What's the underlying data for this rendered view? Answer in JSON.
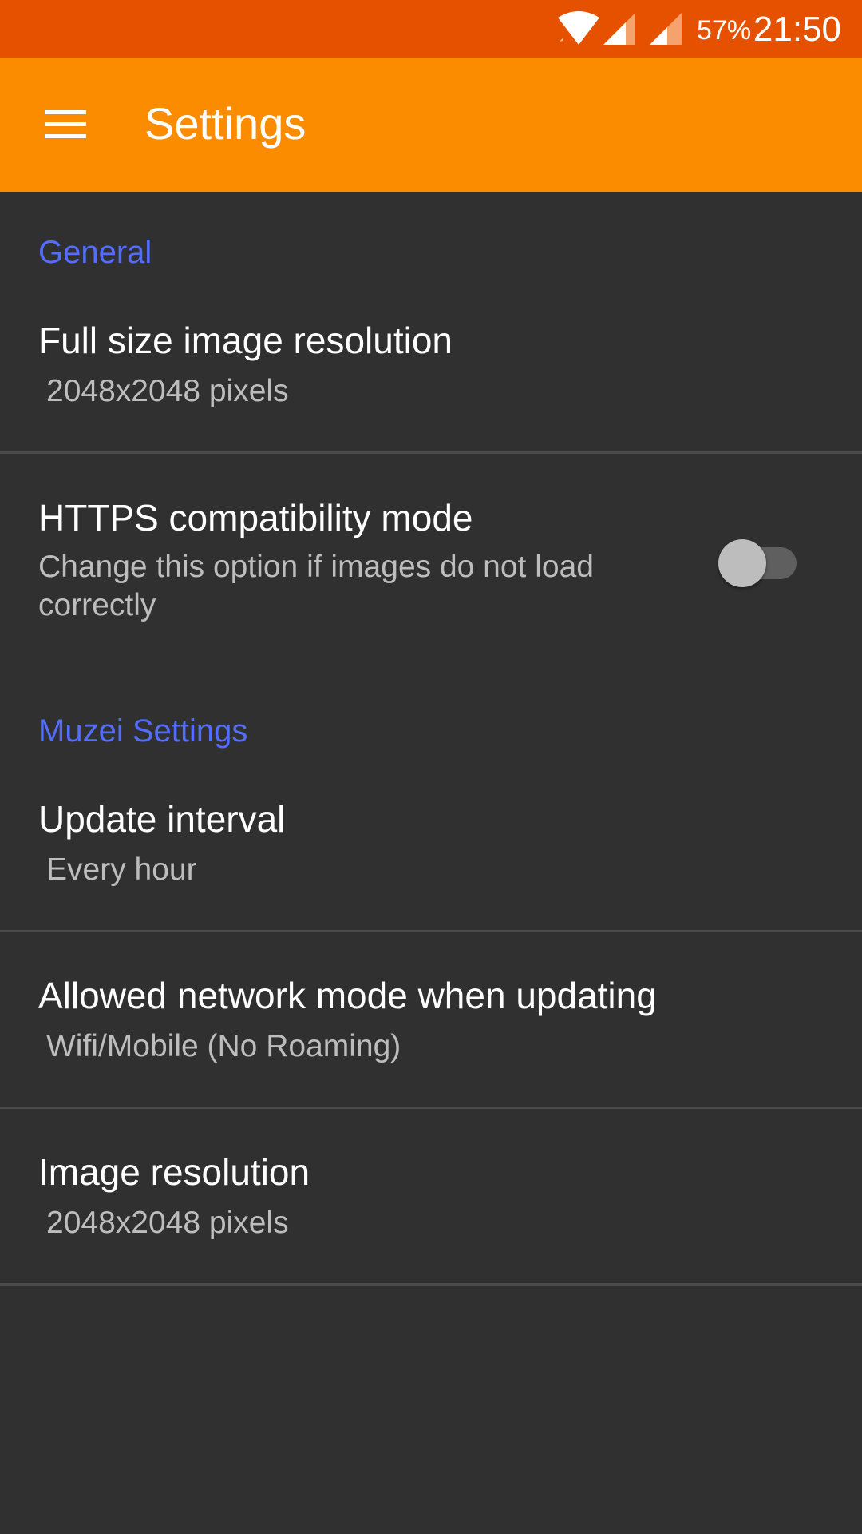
{
  "status_bar": {
    "battery": "57%",
    "time": "21:50",
    "icons": [
      "wifi-icon",
      "cell-signal-icon",
      "cell-signal-icon"
    ]
  },
  "app_bar": {
    "title": "Settings",
    "menu_icon": "hamburger-menu-icon"
  },
  "sections": {
    "general": {
      "header": "General",
      "full_size_resolution": {
        "title": "Full size image resolution",
        "summary": "2048x2048 pixels"
      },
      "https_mode": {
        "title": "HTTPS compatibility mode",
        "summary": "Change this option if images do not load correctly",
        "enabled": false
      }
    },
    "muzei": {
      "header": "Muzei Settings",
      "update_interval": {
        "title": "Update interval",
        "summary": "Every hour"
      },
      "network_mode": {
        "title": "Allowed network mode when updating",
        "summary": "Wifi/Mobile (No Roaming)"
      },
      "image_resolution": {
        "title": "Image resolution",
        "summary": "2048x2048 pixels"
      }
    }
  },
  "colors": {
    "status_bar": "#E65100",
    "app_bar": "#FB8C00",
    "background": "#303030",
    "accent": "#536DFE"
  }
}
